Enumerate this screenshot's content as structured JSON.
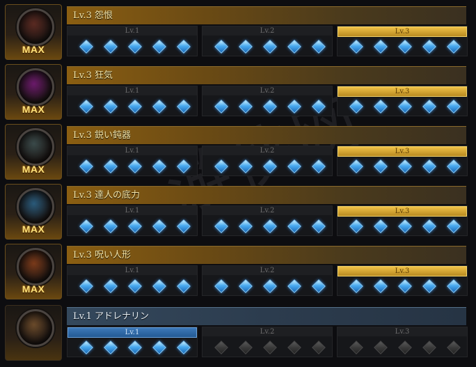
{
  "watermark": "游侠网",
  "level_headers": [
    "Lv.1",
    "Lv.2",
    "Lv.3"
  ],
  "accent_colors": {
    "gold": "#c8922a",
    "blue": "#3c78b8",
    "gem_lit": "#4aaaf0",
    "gem_dim": "#3a3a3a"
  },
  "rows": [
    {
      "title": "Lv.3 怨恨",
      "level": 3,
      "max_badge": "MAX",
      "portrait_color": "#5a2a22",
      "gems_per_level": 5
    },
    {
      "title": "Lv.3 狂気",
      "level": 3,
      "max_badge": "MAX",
      "portrait_color": "#6a1a6a",
      "gems_per_level": 5
    },
    {
      "title": "Lv.3 鋭い鈍器",
      "level": 3,
      "max_badge": "MAX",
      "portrait_color": "#3a4a4a",
      "gems_per_level": 5
    },
    {
      "title": "Lv.3 達人の底力",
      "level": 3,
      "max_badge": "MAX",
      "portrait_color": "#2a5a7a",
      "gems_per_level": 5
    },
    {
      "title": "Lv.3 呪い人形",
      "level": 3,
      "max_badge": "MAX",
      "portrait_color": "#7a3a1a",
      "gems_per_level": 5
    },
    {
      "title": "Lv.1 アドレナリン",
      "level": 1,
      "max_badge": "",
      "portrait_color": "#6a4a2a",
      "gems_per_level": 5
    }
  ]
}
